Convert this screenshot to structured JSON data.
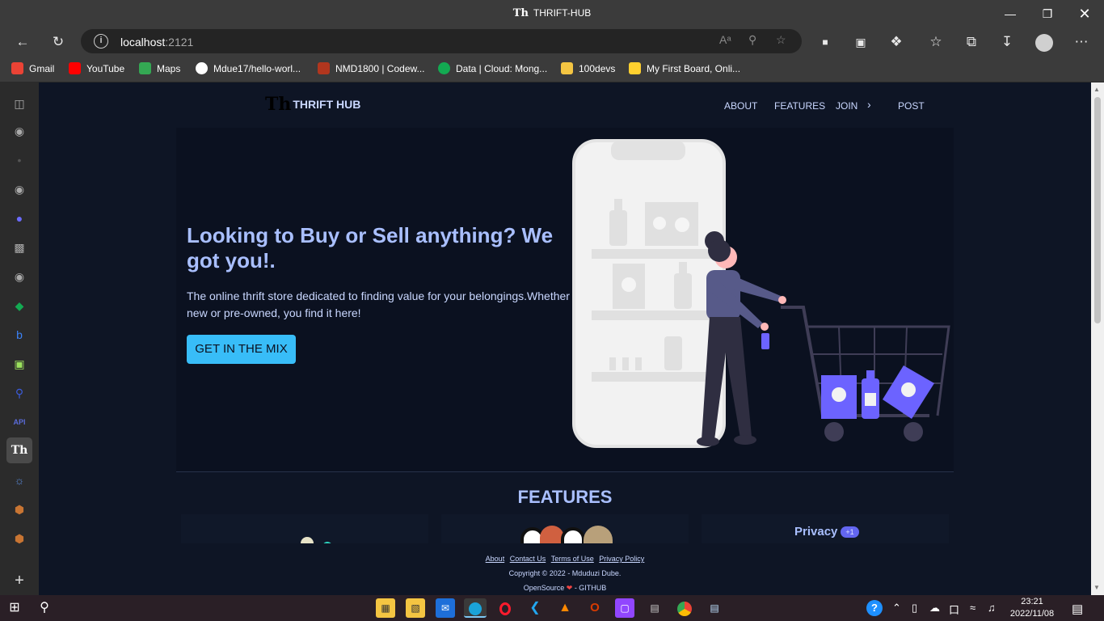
{
  "window": {
    "title": "THRIFT-HUB",
    "title_logo": "Th"
  },
  "toolbar": {
    "url_host": "localhost",
    "url_port": ":2121"
  },
  "bookmarks": [
    {
      "label": "Gmail",
      "icon": "gmail-icon",
      "color": "#ea4335"
    },
    {
      "label": "YouTube",
      "icon": "youtube-icon",
      "color": "#ff0000"
    },
    {
      "label": "Maps",
      "icon": "maps-icon",
      "color": "#34a853"
    },
    {
      "label": "Mdue17/hello-worl...",
      "icon": "github-icon",
      "color": "#ffffff"
    },
    {
      "label": "NMD1800 | Codew...",
      "icon": "codewars-icon",
      "color": "#b1361e"
    },
    {
      "label": "Data | Cloud: Mong...",
      "icon": "mongodb-icon",
      "color": "#13aa52"
    },
    {
      "label": "100devs",
      "icon": "folder-icon",
      "color": "#f4c542"
    },
    {
      "label": "My First Board, Onli...",
      "icon": "miro-icon",
      "color": "#ffd02f"
    }
  ],
  "sidebar_active": "Th",
  "sidebar_api": "API",
  "site": {
    "brand_mark": "Th",
    "brand": "THRIFT HUB",
    "nav": {
      "about": "ABOUT",
      "features": "FEATURES",
      "join": "JOIN",
      "post": "POST"
    },
    "hero": {
      "headline": "Looking to Buy or Sell anything? We got you!.",
      "text": "The online thrift store dedicated to finding value for your belongings.Whether new or pre-owned, you find it here!",
      "cta": "GET IN THE MIX"
    },
    "features_title": "FEATURES",
    "privacy_label": "Privacy",
    "privacy_badge": "+1",
    "footer": {
      "links": {
        "about": "About",
        "contact": "Contact Us",
        "terms": "Terms of Use",
        "privacy": "Privacy Policy"
      },
      "copyright": "Copyright © 2022 - Mduduzi Dube.",
      "opensource": "OpenSource",
      "github": "- GITHUB"
    }
  },
  "taskbar": {
    "time": "23:21",
    "date": "2022/11/08"
  },
  "colors": {
    "page_bg": "#0e1525",
    "accent": "#38bdf8",
    "heading": "#a9bfff",
    "badge": "#6366f1"
  }
}
